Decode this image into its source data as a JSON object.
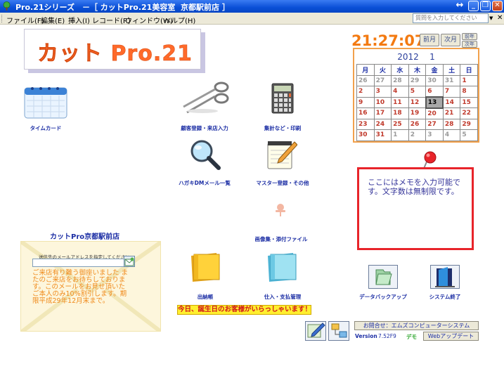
{
  "window": {
    "title": "Pro.21シリーズ　－［ カットPro.21美容室  京都駅前店 ］",
    "icon": "tree-icon"
  },
  "menu": {
    "items": [
      "ファイル(F)",
      "編集(E)",
      "挿入(I)",
      "レコード(R)",
      "ウィンドウ(W)",
      "ヘルプ(H)"
    ],
    "help_placeholder": "質問を入力してください"
  },
  "logo": {
    "text": "カット Pro.21"
  },
  "tiles": {
    "timecard": {
      "label": "タイムカード",
      "icon": "calendar-icon"
    },
    "customer": {
      "label": "顧客登録・来店入力",
      "icon": "scissors-icon"
    },
    "totals": {
      "label": "集計など・印刷",
      "icon": "calculator-icon"
    },
    "dm": {
      "label": "ハガキDMメール一覧",
      "icon": "magnifier-icon"
    },
    "master": {
      "label": "マスター登録・その他",
      "icon": "notepad-pencil-icon"
    },
    "images": {
      "label": "画像集・添付ファイル",
      "icon": "pushpin-icon"
    },
    "cashbook": {
      "label": "出納帳",
      "icon": "yellow-folder-icon"
    },
    "purchase": {
      "label": "仕入・支払管理",
      "icon": "blue-folder-icon"
    },
    "backup": {
      "label": "データバックアップ",
      "icon": "backup-folder-icon"
    },
    "exit": {
      "label": "システム終了",
      "icon": "exit-door-icon"
    }
  },
  "clock": {
    "time": "21:27:07"
  },
  "calendar": {
    "prev_label": "前月",
    "next_label": "次月",
    "prev_year_label": "前年",
    "next_year_label": "次年",
    "year": "2012",
    "month": "1",
    "weekdays": [
      "月",
      "火",
      "水",
      "木",
      "金",
      "土",
      "日"
    ],
    "weeks": [
      [
        {
          "d": "26",
          "m": "oth"
        },
        {
          "d": "27",
          "m": "oth"
        },
        {
          "d": "28",
          "m": "oth"
        },
        {
          "d": "29",
          "m": "oth"
        },
        {
          "d": "30",
          "m": "oth"
        },
        {
          "d": "31",
          "m": "oth"
        },
        {
          "d": "1",
          "m": "cur"
        }
      ],
      [
        {
          "d": "2",
          "m": "cur"
        },
        {
          "d": "3",
          "m": "cur"
        },
        {
          "d": "4",
          "m": "cur"
        },
        {
          "d": "5",
          "m": "cur"
        },
        {
          "d": "6",
          "m": "cur"
        },
        {
          "d": "7",
          "m": "cur"
        },
        {
          "d": "8",
          "m": "cur"
        }
      ],
      [
        {
          "d": "9",
          "m": "cur"
        },
        {
          "d": "10",
          "m": "cur"
        },
        {
          "d": "11",
          "m": "cur"
        },
        {
          "d": "12",
          "m": "cur"
        },
        {
          "d": "13",
          "m": "today"
        },
        {
          "d": "14",
          "m": "cur"
        },
        {
          "d": "15",
          "m": "cur"
        }
      ],
      [
        {
          "d": "16",
          "m": "cur"
        },
        {
          "d": "17",
          "m": "cur"
        },
        {
          "d": "18",
          "m": "cur"
        },
        {
          "d": "19",
          "m": "cur"
        },
        {
          "d": "20",
          "m": "cur"
        },
        {
          "d": "21",
          "m": "cur"
        },
        {
          "d": "22",
          "m": "cur"
        }
      ],
      [
        {
          "d": "23",
          "m": "cur"
        },
        {
          "d": "24",
          "m": "cur"
        },
        {
          "d": "25",
          "m": "cur"
        },
        {
          "d": "26",
          "m": "cur"
        },
        {
          "d": "27",
          "m": "cur"
        },
        {
          "d": "28",
          "m": "cur"
        },
        {
          "d": "29",
          "m": "cur"
        }
      ],
      [
        {
          "d": "30",
          "m": "cur"
        },
        {
          "d": "31",
          "m": "cur"
        },
        {
          "d": "1",
          "m": "oth"
        },
        {
          "d": "2",
          "m": "oth"
        },
        {
          "d": "3",
          "m": "oth"
        },
        {
          "d": "4",
          "m": "oth"
        },
        {
          "d": "5",
          "m": "oth"
        }
      ]
    ]
  },
  "memo": {
    "text": "ここにはメモを入力可能です。文字数は無制限です。"
  },
  "mail": {
    "shop_name": "カットPro京都駅前店",
    "caption": "送信先のメールアドレスを指定してください。",
    "message": "ご来店有り難う御座いました またのご来店をお待ちしております。このメールをお見せ頂いたご本人のみ10%割引します。期限平成29年12月末まで。"
  },
  "birthday_banner": "今日、誕生日のお客様がいらっしゃいます！",
  "info": {
    "contact_label": "お問合せ：エムズコンピューターシステム",
    "version_label": "Version",
    "version_value": "7.52F9",
    "demo_label": "デモ",
    "web_update_label": "Webアップデート"
  },
  "colors": {
    "title_bar": "#0a4fd6",
    "clock": "#f37a11",
    "calendar_border": "#f2a14c",
    "memo_border": "#e8242a",
    "label_blue": "#1d2fa5",
    "banner_bg": "#ffef2f",
    "banner_text": "#d0121a"
  }
}
